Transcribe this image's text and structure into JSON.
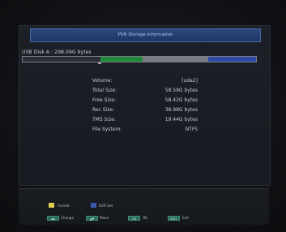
{
  "title": "PVR Storage Information",
  "disk": {
    "label": "USB Disk A :",
    "total": "298.09G bytes"
  },
  "usage_bar": {
    "colors": {
      "recorded": "#2b2e36",
      "tms": "#1f8a3a",
      "free": "#7a7c84",
      "system": "#2f4aa6"
    }
  },
  "info": [
    {
      "label": "Volume:",
      "value": "[uda2]"
    },
    {
      "label": "Total Size:",
      "value": "58.59G bytes"
    },
    {
      "label": "Free Size:",
      "value": "58.42G bytes"
    },
    {
      "label": "Rec Size:",
      "value": "38.98G bytes"
    },
    {
      "label": "TMS Size:",
      "value": "19.44G bytes"
    },
    {
      "label": "File System:",
      "value": "NTFS"
    }
  ],
  "legend": {
    "format": "Format",
    "dvr_set": "DVR Set",
    "format_color": "#e1cf4e",
    "dvr_set_color": "#3a58b0"
  },
  "keys": [
    {
      "key": "◄►",
      "label": "Change",
      "icon": "left-right-arrows-icon"
    },
    {
      "key": "▲▼",
      "label": "Move",
      "icon": "up-down-arrows-icon"
    },
    {
      "key": "OK",
      "label": "OK",
      "icon": "ok-key-icon"
    },
    {
      "key": "EXIT",
      "label": "Exit",
      "icon": "exit-key-icon"
    }
  ]
}
